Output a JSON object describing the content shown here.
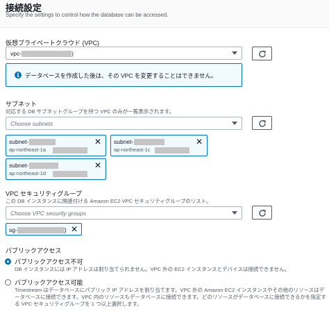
{
  "header": {
    "title": "接続設定",
    "subtitle": "Specify the settings to control how the database can be accessed."
  },
  "vpc": {
    "label": "仮想プライベートクラウド (VPC)",
    "selected_prefix": "vpc-",
    "selected_suffix": ")",
    "info_text": "データベースを作成した後は、その VPC を変更することはできません。"
  },
  "subnet": {
    "label": "サブネット",
    "description": "対応する DB サブネットグループを持つ VPC のみが一覧表示されます。",
    "placeholder": "Choose subnets",
    "tokens": [
      {
        "name": "subnet-",
        "az": "ap-northeast-1a"
      },
      {
        "name": "subnet-",
        "az": "ap-northeast-1c"
      },
      {
        "name": "subnet-",
        "az": "ap-northeast-1d"
      }
    ]
  },
  "security_group": {
    "label": "VPC セキュリティグループ",
    "description": "この DB インスタンスに関連付ける Amazon EC2 VPC セキュリティグループのリスト。",
    "placeholder": "Choose VPC security groups",
    "token_prefix": "sg-",
    "token_suffix": ")"
  },
  "public_access": {
    "label": "パブリックアクセス",
    "options": [
      {
        "label": "パブリックアクセス不可",
        "description": "DB インスタンスには IP アドレスは割り当てられません。VPC 外の EC2 インスタンスとデバイスは接続できません。",
        "selected": true
      },
      {
        "label": "パブリックアクセス可能",
        "description": "Timestream はデータベースにパブリック IP アドレスを割り当てます。VPC 外の Amazon EC2 インスタンスやその他のリソースはデータベースに接続できます。VPC 内のリソースもデータベースに接続できます。どのリソースがデータベースに接続できるかを指定する VPC セキュリティグループを 1 つ以上選択します。",
        "selected": false
      }
    ]
  },
  "icons": {
    "refresh": "refresh-icon",
    "info": "info-icon",
    "remove": "close-icon",
    "dropdown": "caret-down-icon"
  },
  "colors": {
    "accent": "#0073bb",
    "info_bg": "#f1faff",
    "border": "#aab7b8"
  }
}
